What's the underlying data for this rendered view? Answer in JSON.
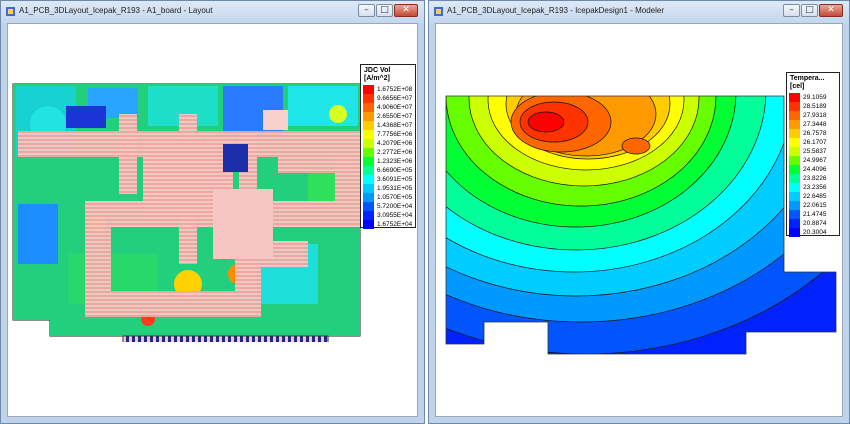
{
  "windows": [
    {
      "title": "A1_PCB_3DLayout_Icepak_R193 - A1_board - Layout"
    },
    {
      "title": "A1_PCB_3DLayout_Icepak_R193 - IcepakDesign1 - Modeler"
    }
  ],
  "left_legend": {
    "title_line1": "JDC Vol",
    "title_line2": "[A/m^2]",
    "entries": [
      {
        "label": "1.6752E+08",
        "color": "#ff0000"
      },
      {
        "label": "9.6656E+07",
        "color": "#ff3300"
      },
      {
        "label": "4.9060E+07",
        "color": "#ff6600"
      },
      {
        "label": "2.6550E+07",
        "color": "#ff9900"
      },
      {
        "label": "1.4368E+07",
        "color": "#ffcc00"
      },
      {
        "label": "7.7756E+06",
        "color": "#ffff00"
      },
      {
        "label": "4.2079E+06",
        "color": "#ccff00"
      },
      {
        "label": "2.2772E+06",
        "color": "#66ff00"
      },
      {
        "label": "1.2323E+06",
        "color": "#00ff33"
      },
      {
        "label": "6.6690E+05",
        "color": "#00ff99"
      },
      {
        "label": "3.6091E+05",
        "color": "#00ffff"
      },
      {
        "label": "1.9531E+05",
        "color": "#00ccff"
      },
      {
        "label": "1.0570E+05",
        "color": "#0099ff"
      },
      {
        "label": "5.7200E+04",
        "color": "#0055ff"
      },
      {
        "label": "3.0955E+04",
        "color": "#0022ff"
      },
      {
        "label": "1.6752E+04",
        "color": "#0000ff"
      }
    ]
  },
  "right_legend": {
    "title_line1": "Tempera...",
    "title_line2": "[cel]",
    "entries": [
      {
        "label": "29.1059",
        "color": "#ff0000"
      },
      {
        "label": "28.5189",
        "color": "#ff3300"
      },
      {
        "label": "27.9318",
        "color": "#ff6600"
      },
      {
        "label": "27.3448",
        "color": "#ff9900"
      },
      {
        "label": "26.7578",
        "color": "#ffcc00"
      },
      {
        "label": "26.1707",
        "color": "#ffff00"
      },
      {
        "label": "25.5837",
        "color": "#ccff00"
      },
      {
        "label": "24.9967",
        "color": "#66ff00"
      },
      {
        "label": "24.4096",
        "color": "#00ff33"
      },
      {
        "label": "23.8226",
        "color": "#00ff99"
      },
      {
        "label": "23.2356",
        "color": "#00ffff"
      },
      {
        "label": "22.6485",
        "color": "#00ccff"
      },
      {
        "label": "22.0615",
        "color": "#0099ff"
      },
      {
        "label": "21.4745",
        "color": "#0055ff"
      },
      {
        "label": "20.8874",
        "color": "#0022ff"
      },
      {
        "label": "20.3004",
        "color": "#0000ff"
      }
    ]
  },
  "icons": {
    "minimize": "minimize-icon",
    "maximize": "maximize-icon",
    "close": "close-icon",
    "minimize_glyph": "–",
    "maximize_glyph": "□",
    "close_glyph": "✕"
  }
}
